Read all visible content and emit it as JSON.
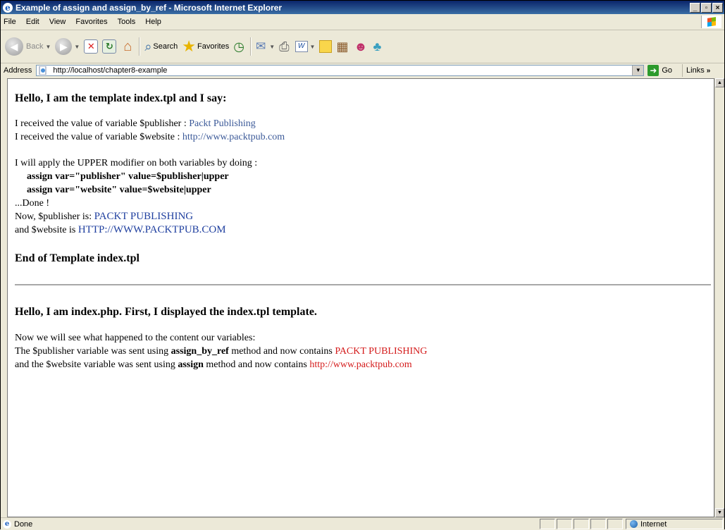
{
  "window": {
    "title": "Example of assign and assign_by_ref - Microsoft Internet Explorer",
    "app_icon_glyph": "e",
    "buttons": {
      "minimize": "_",
      "maximize": "▫",
      "close": "×"
    }
  },
  "menu": {
    "items": [
      "File",
      "Edit",
      "View",
      "Favorites",
      "Tools",
      "Help"
    ]
  },
  "toolbar": {
    "back_label": "Back",
    "search_label": "Search",
    "favorites_label": "Favorites",
    "word_label": "W"
  },
  "address": {
    "label": "Address",
    "url": "http://localhost/chapter8-example",
    "go_label": "Go",
    "links_label": "Links"
  },
  "content": {
    "heading1": "Hello, I am the template index.tpl and I say:",
    "received_publisher_prefix": "I received the value of variable $publisher : ",
    "received_publisher_value": "Packt Publishing",
    "received_website_prefix": "I received the value of variable $website : ",
    "received_website_value": "http://www.packtpub.com",
    "apply_line": "I will apply the UPPER modifier on both variables by doing :",
    "assign_publisher_code": "assign var=\"publisher\" value=$publisher|upper",
    "assign_website_code": "assign var=\"website\" value=$website|upper",
    "done_line": "...Done !",
    "now_publisher_prefix": "Now, $publisher is: ",
    "now_publisher_value": "PACKT PUBLISHING",
    "now_website_prefix": "and $website is ",
    "now_website_value": "HTTP://WWW.PACKTPUB.COM",
    "heading2": "End of Template index.tpl",
    "heading3": "Hello, I am index.php. First, I displayed the index.tpl template.",
    "see_line": "Now we will see what happened to the content our variables:",
    "by_ref_prefix": "The $publisher variable was sent using ",
    "by_ref_method": "assign_by_ref",
    "by_ref_middle": " method and now contains ",
    "by_ref_value": "PACKT PUBLISHING",
    "assign_prefix": "and the $website variable was sent using ",
    "assign_method": "assign",
    "assign_middle": " method and now contains ",
    "assign_value": "http://www.packtpub.com"
  },
  "status": {
    "text": "Done",
    "zone": "Internet"
  },
  "colors": {
    "title_bar": "#0a246a",
    "link_blue": "#3b5998",
    "value_red": "#d41a1a"
  }
}
